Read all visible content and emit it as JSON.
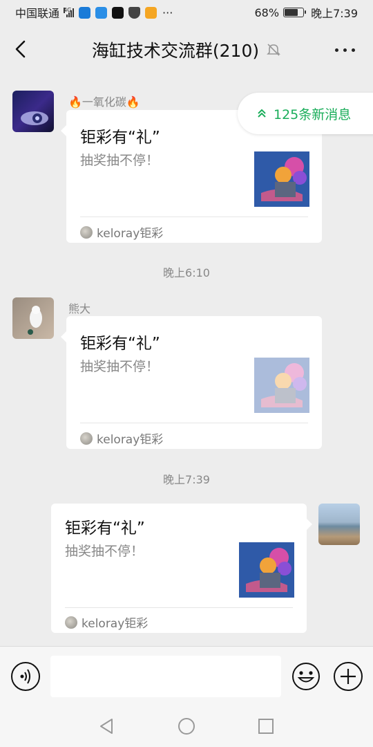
{
  "status_bar": {
    "carrier": "中国联通",
    "network": "4G",
    "battery": "68%",
    "battery_level": 0.68,
    "time": "晚上7:39",
    "overflow": "···"
  },
  "header": {
    "title": "海缸技术交流群(210)",
    "icons": {
      "back": "chevron-left-icon",
      "mute": "bell-off-icon",
      "more": "more-dots-icon"
    }
  },
  "new_messages": {
    "label": "125条新消息",
    "color": "#1aad5a"
  },
  "messages": [
    {
      "sender": "🔥一氧化碳🔥",
      "card": {
        "title": "钜彩有“礼”",
        "desc": "抽奖抽不停！",
        "source": "keloray钜彩"
      }
    },
    {
      "time": "晚上6:10"
    },
    {
      "sender": "熊大",
      "card": {
        "title": "钜彩有“礼”",
        "desc": "抽奖抽不停！",
        "source": "keloray钜彩"
      }
    },
    {
      "time": "晚上7:39"
    },
    {
      "sender": "",
      "card": {
        "title": "钜彩有“礼”",
        "desc": "抽奖抽不停！",
        "source": "keloray钜彩"
      }
    }
  ],
  "input_bar": {
    "placeholder": "",
    "icons": {
      "voice": "voice-icon",
      "emoji": "emoji-icon",
      "plus": "plus-icon"
    }
  },
  "system_nav": {
    "icons": [
      "back-triangle-icon",
      "home-circle-icon",
      "recents-square-icon"
    ]
  }
}
